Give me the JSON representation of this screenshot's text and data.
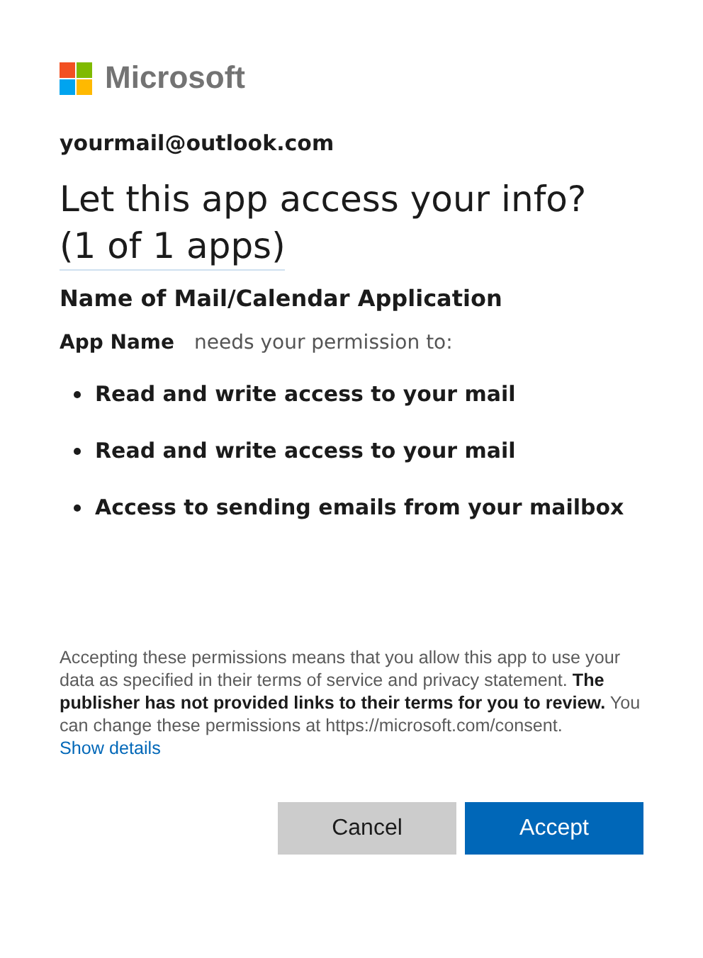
{
  "brand": {
    "name": "Microsoft"
  },
  "account": "yourmail@outlook.com",
  "title": "Let this app access your info?",
  "count": "(1 of 1 apps)",
  "app_title": "Name of Mail/Calendar Application",
  "request": {
    "app_name": "App Name",
    "text": "needs your permission to:"
  },
  "permissions": [
    {
      "text": "Read and write access to your mail"
    },
    {
      "text": "Read and write access to your mail"
    },
    {
      "text": "Access to sending emails from your mailbox"
    }
  ],
  "disclaimer": {
    "text": "Accepting these permissions means that you allow this app to use your data as specified in their terms of service and privacy statement. **The publisher has not provided links to their terms for you to review.** You can change these permissions at https://microsoft.com/consent.",
    "link": "Show details"
  },
  "buttons": [
    {
      "label": "Cancel",
      "kind": "secondary"
    },
    {
      "label": "Accept",
      "kind": "primary"
    }
  ]
}
